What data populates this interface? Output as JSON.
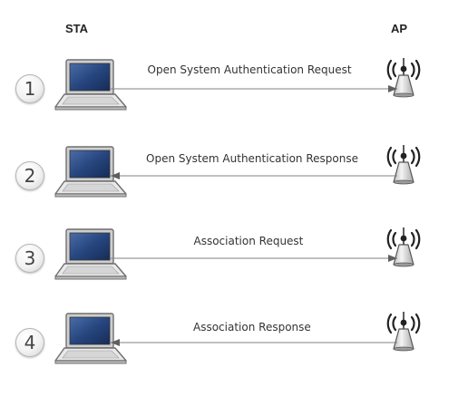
{
  "columns": {
    "left": "STA",
    "right": "AP"
  },
  "steps": [
    {
      "number": "1",
      "label": "Open System Authentication Request",
      "direction": "to-ap"
    },
    {
      "number": "2",
      "label": "Open System Authentication Response",
      "direction": "to-sta"
    },
    {
      "number": "3",
      "label": "Association Request",
      "direction": "to-ap"
    },
    {
      "number": "4",
      "label": "Association Response",
      "direction": "to-sta"
    }
  ],
  "icons": {
    "station": "laptop-icon",
    "access_point": "wireless-access-point-icon"
  },
  "colors": {
    "arrow": "#808080",
    "screen": "#1f3e73",
    "ap_body": "#e4e4e4"
  }
}
